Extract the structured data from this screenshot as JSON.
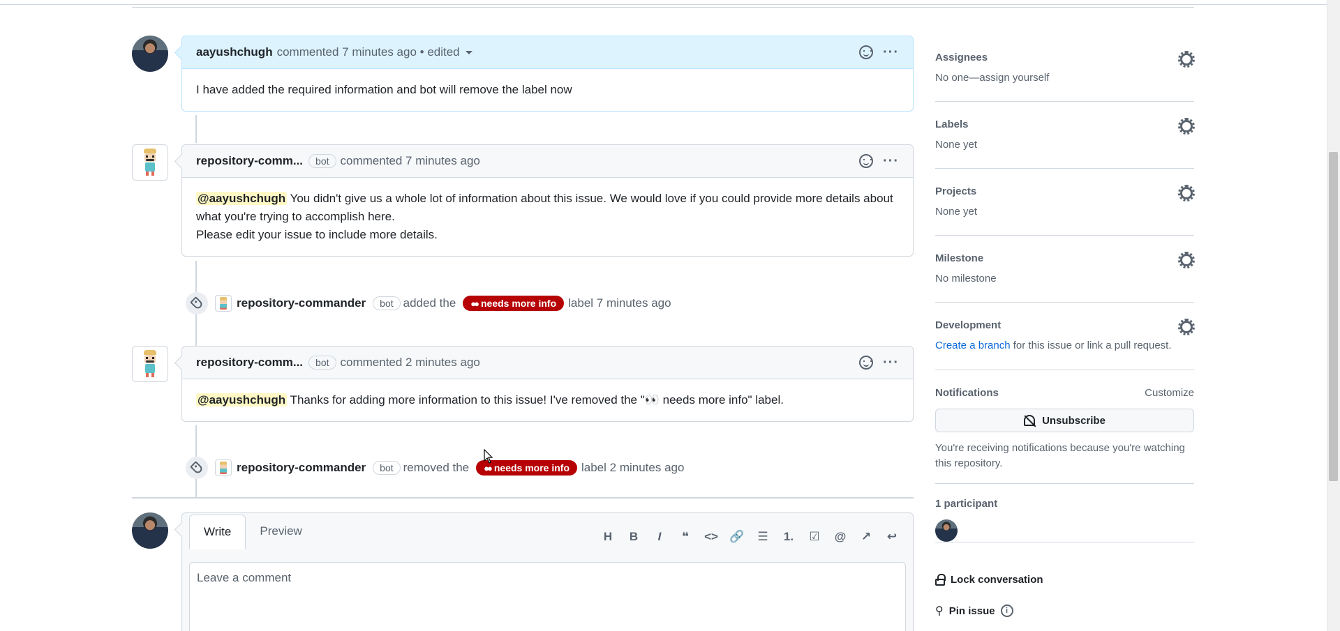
{
  "comments": [
    {
      "author": "aayushchugh",
      "meta": "commented 7 minutes ago • edited",
      "body": "I have added the required information and bot will remove the label now"
    },
    {
      "author": "repository-comm...",
      "badge": "bot",
      "meta": "commented 7 minutes ago",
      "mention": "@aayushchugh",
      "body_after_mention": " You didn't give us a whole lot of information about this issue. We would love if you could provide more details about what you're trying to accomplish here.",
      "body_line2": "Please edit your issue to include more details."
    },
    {
      "author": "repository-comm...",
      "badge": "bot",
      "meta": "commented 2 minutes ago",
      "mention": "@aayushchugh",
      "body_after_mention": " Thanks for adding more information to this issue! I've removed the \"👀 needs more info\" label."
    }
  ],
  "events": [
    {
      "actor": "repository-commander",
      "badge": "bot",
      "action": "added the",
      "label": "needs more info",
      "suffix": "label 7 minutes ago"
    },
    {
      "actor": "repository-commander",
      "badge": "bot",
      "action": "removed the",
      "label": "needs more info",
      "suffix": "label 2 minutes ago"
    }
  ],
  "composer": {
    "tab_write": "Write",
    "tab_preview": "Preview",
    "placeholder": "Leave a comment",
    "toolbar": [
      "H",
      "B",
      "I",
      "❝",
      "<>",
      "🔗",
      "☰",
      "1.",
      "☑",
      "@",
      "↗",
      "↩"
    ]
  },
  "sidebar": {
    "assignees_title": "Assignees",
    "assignees_value": "No one—assign yourself",
    "labels_title": "Labels",
    "labels_value": "None yet",
    "projects_title": "Projects",
    "projects_value": "None yet",
    "milestone_title": "Milestone",
    "milestone_value": "No milestone",
    "development_title": "Development",
    "development_link": "Create a branch",
    "development_rest": " for this issue or link a pull request.",
    "notifications_title": "Notifications",
    "customize": "Customize",
    "unsubscribe": "Unsubscribe",
    "notif_note": "You're receiving notifications because you're watching this repository.",
    "participants": "1 participant",
    "lock": "Lock conversation",
    "pin": "Pin issue"
  },
  "colors": {
    "label_bg": "#b60205",
    "link": "#0969da",
    "mention_bg": "#fff8c5"
  }
}
